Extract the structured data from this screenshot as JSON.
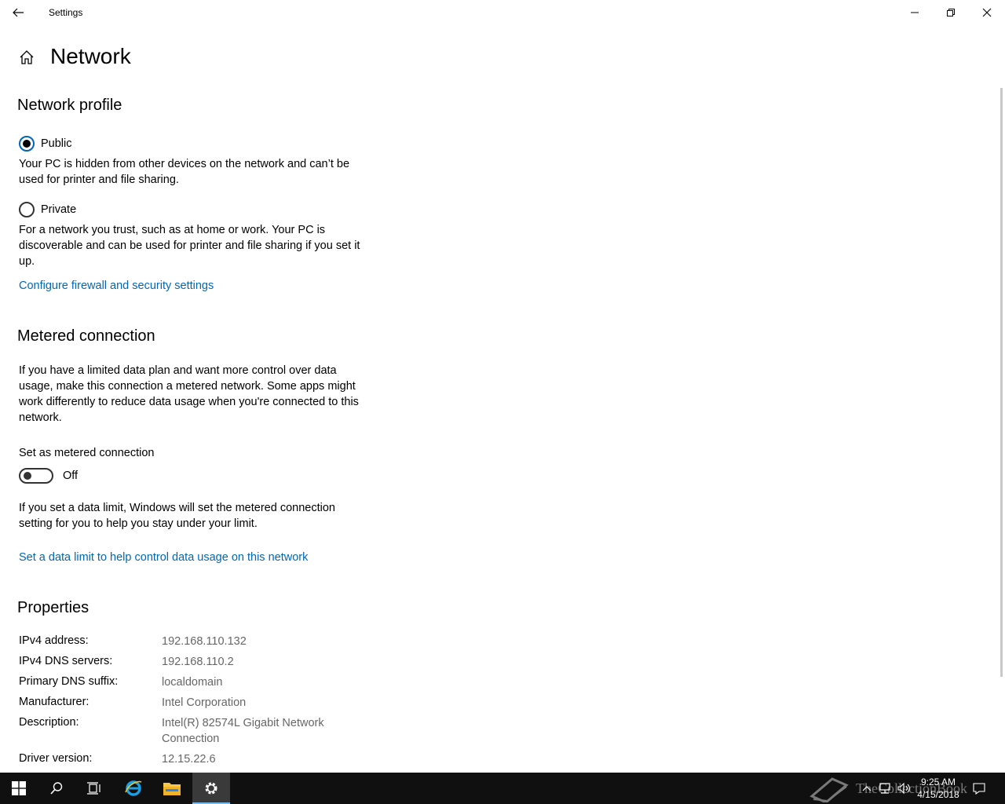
{
  "window": {
    "title": "Settings"
  },
  "page": {
    "title": "Network"
  },
  "network_profile": {
    "heading": "Network profile",
    "options": [
      {
        "label": "Public",
        "selected": true,
        "description": "Your PC is hidden from other devices on the network and can’t be used for printer and file sharing."
      },
      {
        "label": "Private",
        "selected": false,
        "description": "For a network you trust, such as at home or work. Your PC is discoverable and can be used for printer and file sharing if you set it up."
      }
    ],
    "firewall_link": "Configure firewall and security settings"
  },
  "metered": {
    "heading": "Metered connection",
    "description": "If you have a limited data plan and want more control over data usage, make this connection a metered network. Some apps might work differently to reduce data usage when you're connected to this network.",
    "toggle_label": "Set as metered connection",
    "toggle_state": "Off",
    "limit_note": "If you set a data limit, Windows will set the metered connection setting for you to help you stay under your limit.",
    "limit_link": "Set a data limit to help control data usage on this network"
  },
  "properties": {
    "heading": "Properties",
    "rows": [
      {
        "label": "IPv4 address:",
        "value": "192.168.110.132"
      },
      {
        "label": "IPv4 DNS servers:",
        "value": "192.168.110.2"
      },
      {
        "label": "Primary DNS suffix:",
        "value": "localdomain"
      },
      {
        "label": "Manufacturer:",
        "value": "Intel Corporation"
      },
      {
        "label": "Description:",
        "value": "Intel(R) 82574L Gigabit Network Connection"
      },
      {
        "label": "Driver version:",
        "value": "12.15.22.6"
      }
    ]
  },
  "taskbar": {
    "time": "9:25 AM",
    "date": "4/15/2018",
    "watermark": "TheCollectionBook",
    "accent": "#76b9ed"
  },
  "colors": {
    "link": "#0067b8",
    "value_text": "#666666"
  }
}
